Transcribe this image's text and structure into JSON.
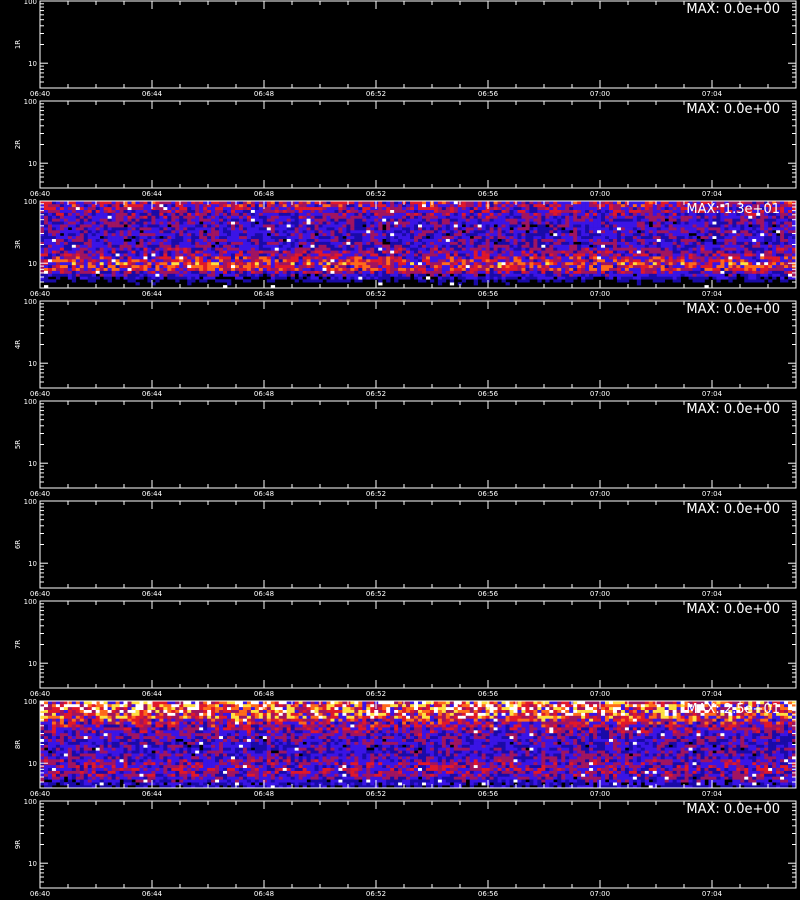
{
  "figure": {
    "background": "#000000",
    "axis_color": "#ffffff",
    "bottom_caption": "",
    "colorscale": [
      "#000000",
      "#1a0aa8",
      "#3a14e6",
      "#a01460",
      "#e0182a",
      "#ff6a1a",
      "#ffe040",
      "#ffffff"
    ]
  },
  "chart_data": [
    {
      "type": "heatmap",
      "ylabel": "1R",
      "max_label": "MAX: 0.0e+00",
      "max_value": 0.0,
      "yscale": "log",
      "ylim": [
        4,
        100
      ],
      "yticks": [
        "100",
        "10"
      ],
      "xticks": [
        "06:40",
        "06:44",
        "06:48",
        "06:52",
        "06:56",
        "07:00",
        "07:04"
      ],
      "xlim": [
        "06:40",
        "07:07"
      ],
      "grid": false
    },
    {
      "type": "heatmap",
      "ylabel": "2R",
      "max_label": "MAX: 0.0e+00",
      "max_value": 0.0,
      "yscale": "log",
      "ylim": [
        4,
        100
      ],
      "yticks": [
        "100",
        "10"
      ],
      "xticks": [
        "06:40",
        "06:44",
        "06:48",
        "06:52",
        "06:56",
        "07:00",
        "07:04"
      ],
      "xlim": [
        "06:40",
        "07:07"
      ],
      "grid": false
    },
    {
      "type": "heatmap",
      "ylabel": "3R",
      "max_label": "MAX: 1.3e+01",
      "max_value": 13.0,
      "yscale": "log",
      "ylim": [
        4,
        100
      ],
      "yticks": [
        "100",
        "10"
      ],
      "xticks": [
        "06:40",
        "06:44",
        "06:48",
        "06:52",
        "06:56",
        "07:00",
        "07:04"
      ],
      "xlim": [
        "06:40",
        "07:07"
      ],
      "grid": false,
      "intensity_profile": {
        "y": [
          4,
          5,
          6,
          7,
          8,
          9,
          10,
          12,
          15,
          20,
          30,
          45,
          60,
          80,
          100
        ],
        "relative_level": [
          0.05,
          0.1,
          0.2,
          0.35,
          0.5,
          0.55,
          0.6,
          0.5,
          0.4,
          0.32,
          0.3,
          0.32,
          0.38,
          0.45,
          0.5
        ]
      }
    },
    {
      "type": "heatmap",
      "ylabel": "4R",
      "max_label": "MAX: 0.0e+00",
      "max_value": 0.0,
      "yscale": "log",
      "ylim": [
        4,
        100
      ],
      "yticks": [
        "100",
        "10"
      ],
      "xticks": [
        "06:40",
        "06:44",
        "06:48",
        "06:52",
        "06:56",
        "07:00",
        "07:04"
      ],
      "xlim": [
        "06:40",
        "07:07"
      ],
      "grid": false
    },
    {
      "type": "heatmap",
      "ylabel": "5R",
      "max_label": "MAX: 0.0e+00",
      "max_value": 0.0,
      "yscale": "log",
      "ylim": [
        4,
        100
      ],
      "yticks": [
        "100",
        "10"
      ],
      "xticks": [
        "06:40",
        "06:44",
        "06:48",
        "06:52",
        "06:56",
        "07:00",
        "07:04"
      ],
      "xlim": [
        "06:40",
        "07:07"
      ],
      "grid": false
    },
    {
      "type": "heatmap",
      "ylabel": "6R",
      "max_label": "MAX: 0.0e+00",
      "max_value": 0.0,
      "yscale": "log",
      "ylim": [
        4,
        100
      ],
      "yticks": [
        "100",
        "10"
      ],
      "xticks": [
        "06:40",
        "06:44",
        "06:48",
        "06:52",
        "06:56",
        "07:00",
        "07:04"
      ],
      "xlim": [
        "06:40",
        "07:07"
      ],
      "grid": false
    },
    {
      "type": "heatmap",
      "ylabel": "7R",
      "max_label": "MAX: 0.0e+00",
      "max_value": 0.0,
      "yscale": "log",
      "ylim": [
        4,
        100
      ],
      "yticks": [
        "100",
        "10"
      ],
      "xticks": [
        "06:40",
        "06:44",
        "06:48",
        "06:52",
        "06:56",
        "07:00",
        "07:04"
      ],
      "xlim": [
        "06:40",
        "07:07"
      ],
      "grid": false
    },
    {
      "type": "heatmap",
      "ylabel": "8R",
      "max_label": "MAX: 2.5e+01",
      "max_value": 25.0,
      "yscale": "log",
      "ylim": [
        4,
        100
      ],
      "yticks": [
        "100",
        "10"
      ],
      "xticks": [
        "06:40",
        "06:44",
        "06:48",
        "06:52",
        "06:56",
        "07:00",
        "07:04"
      ],
      "xlim": [
        "06:40",
        "07:07"
      ],
      "grid": false,
      "intensity_profile": {
        "y": [
          4,
          5,
          6,
          7,
          8,
          9,
          10,
          12,
          15,
          20,
          30,
          45,
          60,
          80,
          100
        ],
        "relative_level": [
          0.15,
          0.25,
          0.35,
          0.4,
          0.42,
          0.42,
          0.4,
          0.35,
          0.3,
          0.3,
          0.35,
          0.5,
          0.7,
          0.8,
          0.7
        ]
      }
    },
    {
      "type": "heatmap",
      "ylabel": "9R",
      "max_label": "MAX: 0.0e+00",
      "max_value": 0.0,
      "yscale": "log",
      "ylim": [
        4,
        100
      ],
      "yticks": [
        "100",
        "10"
      ],
      "xticks": [
        "06:40",
        "06:44",
        "06:48",
        "06:52",
        "06:56",
        "07:00",
        "07:04"
      ],
      "xlim": [
        "06:40",
        "07:07"
      ],
      "grid": false
    }
  ]
}
